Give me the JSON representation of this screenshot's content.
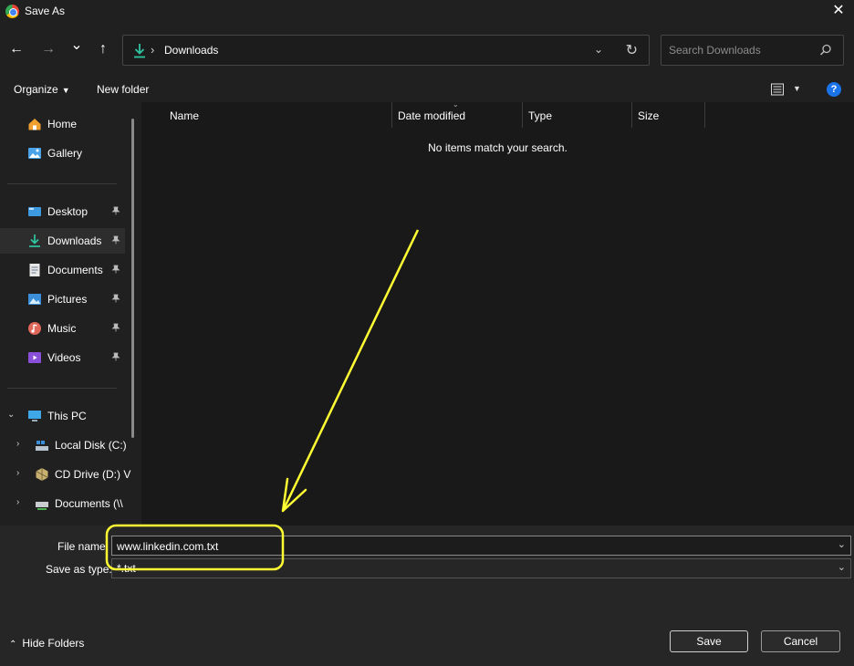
{
  "window": {
    "title": "Save As",
    "close_glyph": "✕"
  },
  "nav": {
    "back_glyph": "←",
    "forward_glyph": "→",
    "recent_glyph": "⌄",
    "up_glyph": "↑",
    "breadcrumb_separator": "›",
    "breadcrumb": "Downloads",
    "dropdown_glyph": "⌄",
    "refresh_glyph": "↻"
  },
  "search": {
    "placeholder": "Search Downloads"
  },
  "toolbar": {
    "organize_label": "Organize",
    "new_folder_label": "New folder",
    "help_glyph": "?"
  },
  "sidebar": {
    "pin_glyph": "📌",
    "expand_glyph": "›",
    "collapse_glyph": "⌄",
    "home": "Home",
    "gallery": "Gallery",
    "desktop": "Desktop",
    "downloads": "Downloads",
    "documents": "Documents",
    "pictures": "Pictures",
    "music": "Music",
    "videos": "Videos",
    "this_pc": "This PC",
    "local_disk": "Local Disk (C:)",
    "cd_drive": "CD Drive (D:) V",
    "documents_net": "Documents (\\\\"
  },
  "columns": {
    "name": "Name",
    "date_modified": "Date modified",
    "type": "Type",
    "size": "Size"
  },
  "content": {
    "empty_message": "No items match your search."
  },
  "form": {
    "file_name_label": "File name:",
    "file_name_value": "www.linkedin.com.txt",
    "save_as_type_label": "Save as type:",
    "save_as_type_value": "*.txt"
  },
  "footer": {
    "hide_folders_label": "Hide Folders",
    "save_label": "Save",
    "cancel_label": "Cancel"
  },
  "annotation": {
    "color": "#ffff33"
  }
}
